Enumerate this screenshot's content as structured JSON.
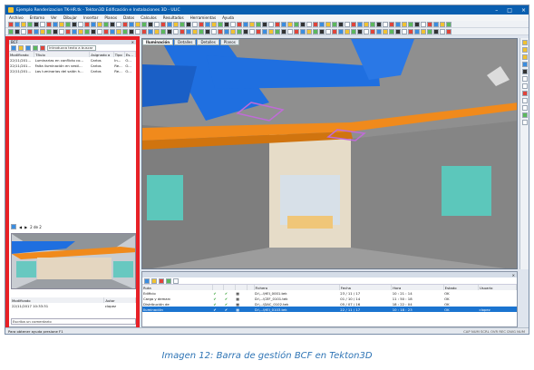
{
  "window": {
    "title": "Ejemplo Renderizacion TK-HR.tk - Tekton3D Edificación e Instalaciones 3D - ULIC"
  },
  "menu": [
    "Archivo",
    "Entorno",
    "Ver",
    "Dibujar",
    "Insertar",
    "Planos",
    "Datos",
    "Calculos",
    "Resultados",
    "Herramientas",
    "Ayuda"
  ],
  "bcf": {
    "header": "BCF",
    "search_placeholder": "Introduzca texto a buscar",
    "columns": [
      "Modificado",
      "Título",
      "Asignado a",
      "Tipo",
      "Es..."
    ],
    "rows": [
      [
        "22/11/201...",
        "Luminarias en conflicto co...",
        "Carlos",
        "In...",
        "O..."
      ],
      [
        "22/11/201...",
        "Falta iluminación en vestí...",
        "Carlos",
        "Re...",
        "O..."
      ],
      [
        "22/11/201...",
        "Las luminarias del salón h...",
        "Carlos",
        "Re...",
        "O..."
      ]
    ],
    "nav_page": "2 de 2",
    "comment_columns": [
      "Modificado",
      "Autor"
    ],
    "comment_row": [
      "22/11/2017 10:33:31",
      "clopez"
    ],
    "comment_placeholder": "Escriba un comentario"
  },
  "viewport": {
    "tabs": [
      "Iluminación",
      "Detalles",
      "Detalles",
      "Planos"
    ]
  },
  "files": {
    "columns": [
      "Ruta",
      "",
      "",
      "",
      "",
      "Fichero",
      "Fecha",
      "Hora",
      "Estado",
      "Usuario"
    ],
    "rows": [
      [
        "Edificio",
        "D:\\...\\HEI_0001.tek",
        "23 / 11 / 17",
        "10 : 21 : 14",
        "OK",
        ""
      ],
      [
        "Cargo y demarc",
        "D:\\...\\CEF_0101.tek",
        "01 / 10 / 14",
        "11 : 50 : 18",
        "OK",
        ""
      ],
      [
        "Distribución de",
        "D:\\...\\DAC_0102.tek",
        "05 / 07 / 16",
        "18 : 22 : 04",
        "OK",
        ""
      ],
      [
        "Iluminación",
        "D:\\...\\HEI_0103.tek",
        "22 / 11 / 17",
        "10 : 18 : 23",
        "OK",
        "clopez"
      ]
    ],
    "tabs": [
      "Capítulos",
      "Errores",
      "Notas",
      "Usuarios"
    ]
  },
  "status": {
    "left": "Para obtener ayuda presione F1",
    "right": "CAP NUM SCRL OVR REC DWG NUM"
  },
  "caption": "Imagen 12: Barra de gestión BCF en Tekton3D",
  "colors": {
    "highlight": "#e82026",
    "selection": "#1b74d0",
    "duct_blue": "#1f6fe0",
    "duct_orange": "#f08a1c",
    "caption": "#2e74b5"
  }
}
